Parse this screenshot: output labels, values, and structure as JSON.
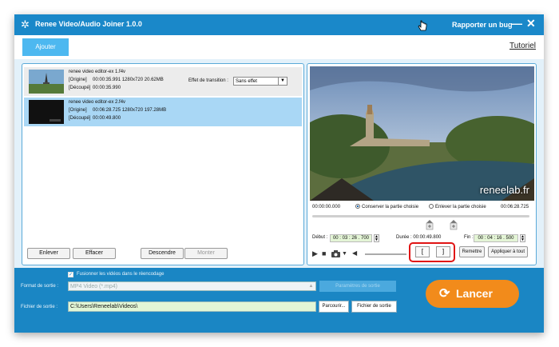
{
  "app": {
    "title": "Renee Video/Audio Joiner 1.0.0",
    "bug_label": "Rapporter un bug",
    "min_label": "—",
    "close_label": "✕"
  },
  "toolbar": {
    "add_label": "Ajouter",
    "tutorial_label": "Tutoriel"
  },
  "files": [
    {
      "name": "renee video editor-ex 1.f4v",
      "origin_label": "[Origine]",
      "origin_info": "00:00:35.991  1280x720  20.62MB",
      "cut_label": "[Découpé]",
      "cut_info": "00:00:35.990",
      "transition_label": "Effet de transition :",
      "transition_value": "Sans effet"
    },
    {
      "name": "renee video editor-ex 2.f4v",
      "origin_label": "[Origine]",
      "origin_info": "00:06:28.725  1280x720  197.28MB",
      "cut_label": "[Découpé]",
      "cut_info": "00:00:49.800"
    }
  ],
  "list_buttons": {
    "remove": "Enlever",
    "clear": "Effacer",
    "down": "Descendre",
    "up": "Monter"
  },
  "preview": {
    "watermark": "reneelab.fr",
    "time_start": "00:00:00.000",
    "keep_label": "Conserver la partie choisie",
    "remove_label": "Enlever la partie choisie",
    "time_end": "00:06:28.725",
    "debut_label": "Début :",
    "debut_value": "00 : 03 : 26 . 700",
    "duree_label": "Durée : 00:00:49.800",
    "fin_label": "Fin :",
    "fin_value": "00 : 04 : 16 . 500",
    "bracket_open": "[",
    "bracket_close": "]",
    "reset_label": "Remettre",
    "apply_all_label": "Appliquer à tout"
  },
  "output": {
    "merge_label": "Fusionner les vidéos dans le réencodage",
    "format_label": "Format de sortie :",
    "format_value": "MP4 Video (*.mp4)",
    "params_label": "Paramètres de sortie",
    "folder_label": "Fichier de sortie :",
    "folder_value": "C:\\Users\\Reneelab\\Videos\\",
    "browse_label": "Parcourir...",
    "open_label": "Fichier de sortie",
    "run_label": "Lancer"
  },
  "colors": {
    "title_bar": "#1a88c9",
    "accent_orange": "#f28b1b",
    "highlight_red": "#e01414",
    "selected_row": "#a9d7f5"
  }
}
